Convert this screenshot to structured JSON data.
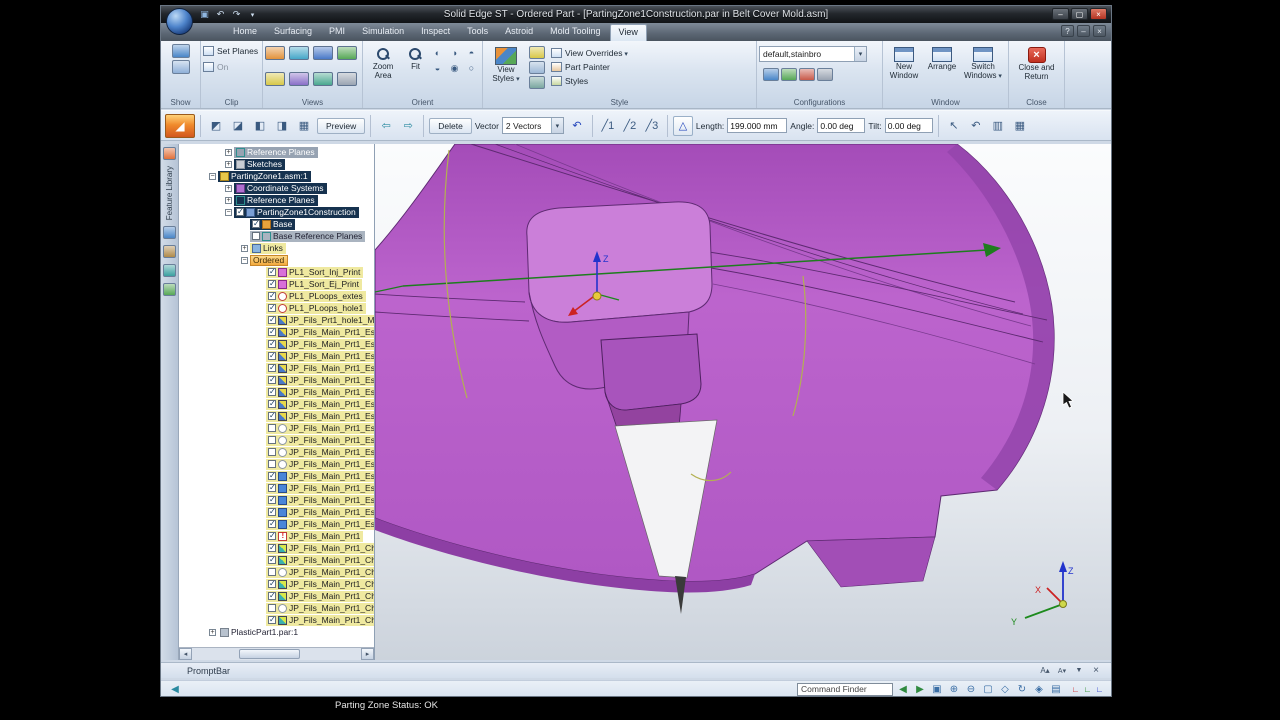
{
  "colors": {
    "model": "#bb63cc",
    "model-dark": "#8d3fa4",
    "model-light": "#cb7fd9",
    "accent-orange": "#f08a2c",
    "highlight-yellow": "#efe9a0",
    "selected-dark": "#16324f"
  },
  "window": {
    "title": "Solid Edge ST - Ordered Part - [PartingZone1Construction.par in Belt Cover Mold.asm]"
  },
  "tabs": [
    {
      "name": "tab-home",
      "label": "Home"
    },
    {
      "name": "tab-surfacing",
      "label": "Surfacing"
    },
    {
      "name": "tab-pmi",
      "label": "PMI"
    },
    {
      "name": "tab-simulation",
      "label": "Simulation"
    },
    {
      "name": "tab-inspect",
      "label": "Inspect"
    },
    {
      "name": "tab-tools",
      "label": "Tools"
    },
    {
      "name": "tab-astroid",
      "label": "Astroid"
    },
    {
      "name": "tab-mold-tooling",
      "label": "Mold Tooling"
    },
    {
      "name": "tab-view",
      "label": "View",
      "classes": [
        "active"
      ]
    }
  ],
  "ribbon": {
    "show": {
      "label": "Show"
    },
    "clip": {
      "label": "Clip",
      "set_planes": "Set Planes",
      "on": "On"
    },
    "views": {
      "label": "Views",
      "icons": [
        {
          "name": "view-top-icon",
          "color": "#e2923c"
        },
        {
          "name": "view-front-icon",
          "color": "#46a7c8"
        },
        {
          "name": "view-right-icon",
          "color": "#4979c8"
        },
        {
          "name": "view-iso-icon",
          "color": "#57a857"
        },
        {
          "name": "view-dimetric-icon",
          "color": "#d8c84a"
        },
        {
          "name": "view-trimetric-icon",
          "color": "#8a6fc8"
        },
        {
          "name": "view-bottom-icon",
          "color": "#4aa890"
        },
        {
          "name": "view-back-icon",
          "color": "#9aa4b2"
        }
      ]
    },
    "orient": {
      "label": "Orient",
      "zoom_area": "Zoom Area",
      "fit": "Fit",
      "icons": [
        {
          "name": "pan-icon",
          "glyph": "◐"
        },
        {
          "name": "rotate-icon",
          "glyph": "◑"
        },
        {
          "name": "spin-about-icon",
          "glyph": "◓"
        },
        {
          "name": "look-at-face-icon",
          "glyph": "◒"
        },
        {
          "name": "camera-icon",
          "glyph": "◉"
        },
        {
          "name": "walk-icon",
          "glyph": "○"
        }
      ]
    },
    "style": {
      "label": "Style",
      "view_styles": "View Styles",
      "view_overrides": "View Overrides",
      "part_painter": "Part Painter",
      "styles": "Styles"
    },
    "configurations": {
      "label": "Configurations",
      "value": "default,stainbro",
      "icons": [
        {
          "name": "config-save-icon",
          "color": "#4a86c8"
        },
        {
          "name": "config-apply-icon",
          "color": "#57a857"
        },
        {
          "name": "config-delete-icon",
          "color": "#c85a4a"
        },
        {
          "name": "config-manage-icon",
          "color": "#9aa4b2"
        }
      ]
    },
    "window_group": {
      "label": "Window",
      "new_window": "New Window",
      "arrange": "Arrange",
      "switch_windows": "Switch Windows"
    },
    "close_group": {
      "label": "Close",
      "close_and_return": "Close and Return"
    }
  },
  "command_bar": {
    "steps": [
      {
        "name": "select-step-icon",
        "glyph": "◩"
      },
      {
        "name": "extend-step-icon",
        "glyph": "◪"
      },
      {
        "name": "side-1-step-icon",
        "glyph": "◧"
      },
      {
        "name": "side-2-step-icon",
        "glyph": "◨"
      },
      {
        "name": "surface-step-icon",
        "glyph": "▦"
      }
    ],
    "preview": "Preview",
    "nav": [
      {
        "name": "previous-step-icon",
        "glyph": "⇦"
      },
      {
        "name": "next-step-icon",
        "glyph": "⇨"
      }
    ],
    "delete": "Delete",
    "vector_label": "Vector",
    "vector_value": "2 Vectors",
    "flip_glyph": "↶",
    "modes": [
      {
        "name": "single-vector-icon",
        "glyph": "╱1"
      },
      {
        "name": "double-vector-icon",
        "glyph": "╱2"
      },
      {
        "name": "multi-vector-icon",
        "glyph": "╱3"
      }
    ],
    "delta_glyph": "△",
    "length_label": "Length:",
    "length_value": "199.000 mm",
    "angle_label": "Angle:",
    "angle_value": "0.00 deg",
    "tilt_label": "Tilt:",
    "tilt_value": "0.00 deg",
    "right_icons": [
      {
        "name": "select-tool-icon",
        "glyph": "↖"
      },
      {
        "name": "undo-step-icon",
        "glyph": "↶"
      },
      {
        "name": "snap-options-icon",
        "glyph": "▥"
      },
      {
        "name": "display-options-icon",
        "glyph": "▦"
      }
    ]
  },
  "left_strip": {
    "feature_library": "Feature Library"
  },
  "pathfinder": {
    "rows": [
      {
        "label": "Reference Planes",
        "style": "gray",
        "icon": "planes",
        "indent": 2,
        "expand": "plus"
      },
      {
        "label": "Sketches",
        "style": "dark",
        "icon": "sketch",
        "indent": 2,
        "expand": "plus"
      },
      {
        "label": "PartingZone1.asm:1",
        "style": "dark",
        "icon": "asm",
        "indent": 1,
        "expand": "minus"
      },
      {
        "label": "Coordinate Systems",
        "style": "dark",
        "icon": "csys",
        "indent": 2,
        "expand": "plus"
      },
      {
        "label": "Reference Planes",
        "style": "dark",
        "icon": "planes",
        "indent": 2,
        "expand": "plus"
      },
      {
        "label": "PartingZone1Construction",
        "style": "dark",
        "icon": "part",
        "state": "checked",
        "indent": 2,
        "expand": "minus"
      },
      {
        "label": "Base",
        "style": "dark",
        "icon": "base",
        "state": "checked",
        "indent": 3
      },
      {
        "label": "Base Reference Planes",
        "style": "gray2",
        "icon": "planes",
        "state": "unchecked",
        "indent": 3
      },
      {
        "label": "Links",
        "style": "yellow",
        "icon": "links",
        "indent": 3,
        "expand": "plus"
      },
      {
        "label": "Ordered",
        "style": "header",
        "indent": 3,
        "expand": "minus"
      },
      {
        "label": "PL1_Sort_Inj_Print",
        "style": "yellow",
        "icon": "surf",
        "state": "checked",
        "indent": 4
      },
      {
        "label": "PL1_Sort_Ej_Print",
        "style": "yellow",
        "icon": "surf",
        "state": "checked",
        "indent": 4
      },
      {
        "label": "PL1_PLoops_extes",
        "style": "yellow",
        "icon": "loop",
        "state": "checked",
        "indent": 4
      },
      {
        "label": "PL1_PLoops_hole1",
        "style": "yellow",
        "icon": "loop",
        "state": "checked",
        "indent": 4
      },
      {
        "label": "JP_Fils_Prt1_hole1_M...",
        "style": "yellow",
        "icon": "fill",
        "state": "checked",
        "indent": 4
      },
      {
        "label": "JP_Fils_Main_Prt1_Es...",
        "style": "yellow",
        "icon": "fill",
        "state": "checked",
        "indent": 4
      },
      {
        "label": "JP_Fils_Main_Prt1_Es...",
        "style": "yellow",
        "icon": "fill",
        "state": "checked",
        "indent": 4
      },
      {
        "label": "JP_Fils_Main_Prt1_Es...",
        "style": "yellow",
        "icon": "fill",
        "state": "checked",
        "indent": 4
      },
      {
        "label": "JP_Fils_Main_Prt1_Es...",
        "style": "yellow",
        "icon": "fill",
        "state": "checked",
        "indent": 4
      },
      {
        "label": "JP_Fils_Main_Prt1_Es...",
        "style": "yellow",
        "icon": "fill",
        "state": "checked",
        "indent": 4
      },
      {
        "label": "JP_Fils_Main_Prt1_Es...",
        "style": "yellow",
        "icon": "fill",
        "state": "checked",
        "indent": 4
      },
      {
        "label": "JP_Fils_Main_Prt1_Es...",
        "style": "yellow",
        "icon": "fill",
        "state": "checked",
        "indent": 4
      },
      {
        "label": "JP_Fils_Main_Prt1_Es...",
        "style": "yellow",
        "icon": "fill",
        "state": "checked",
        "indent": 4
      },
      {
        "label": "JP_Fils_Main_Prt1_Es...",
        "style": "yellow",
        "icon": "loop2",
        "state": "unchecked",
        "indent": 4
      },
      {
        "label": "JP_Fils_Main_Prt1_Es...",
        "style": "yellow",
        "icon": "loop2",
        "state": "unchecked",
        "indent": 4
      },
      {
        "label": "JP_Fils_Main_Prt1_Es...",
        "style": "yellow",
        "icon": "loop2",
        "state": "unchecked",
        "indent": 4
      },
      {
        "label": "JP_Fils_Main_Prt1_Es...",
        "style": "yellow",
        "icon": "loop2",
        "state": "unchecked",
        "indent": 4
      },
      {
        "label": "JP_Fils_Main_Prt1_Es_",
        "style": "yellow",
        "icon": "blue",
        "state": "checked",
        "indent": 4
      },
      {
        "label": "JP_Fils_Main_Prt1_Es_",
        "style": "yellow",
        "icon": "blue",
        "state": "checked",
        "indent": 4
      },
      {
        "label": "JP_Fils_Main_Prt1_Es_",
        "style": "yellow",
        "icon": "blue",
        "state": "checked",
        "indent": 4
      },
      {
        "label": "JP_Fils_Main_Prt1_Es_",
        "style": "yellow",
        "icon": "blue",
        "state": "checked",
        "indent": 4
      },
      {
        "label": "JP_Fils_Main_Prt1_Es_",
        "style": "yellow",
        "icon": "blue",
        "state": "checked",
        "indent": 4
      },
      {
        "label": "JP_Fils_Main_Prt1",
        "style": "yellow",
        "icon": "warn",
        "state": "checked",
        "indent": 4
      },
      {
        "label": "JP_Fils_Main_Prt1_Ch...",
        "style": "yellow",
        "icon": "fill2",
        "state": "checked",
        "indent": 4
      },
      {
        "label": "JP_Fils_Main_Prt1_Ch...",
        "style": "yellow",
        "icon": "fill2",
        "state": "checked",
        "indent": 4
      },
      {
        "label": "JP_Fils_Main_Prt1_Ch...",
        "style": "yellow",
        "icon": "loop2",
        "state": "unchecked",
        "indent": 4
      },
      {
        "label": "JP_Fils_Main_Prt1_Ch...",
        "style": "yellow",
        "icon": "fill2",
        "state": "checked",
        "indent": 4
      },
      {
        "label": "JP_Fils_Main_Prt1_Ch...",
        "style": "yellow",
        "icon": "fill2",
        "state": "checked",
        "indent": 4
      },
      {
        "label": "JP_Fils_Main_Prt1_Ch...",
        "style": "yellow",
        "icon": "loop2",
        "state": "unchecked",
        "indent": 4
      },
      {
        "label": "JP_Fils_Main_Prt1_Ch...",
        "style": "yellow",
        "icon": "fill2",
        "state": "checked",
        "indent": 4
      },
      {
        "label": "PlasticPart1.par:1",
        "style": "plain",
        "icon": "part2",
        "indent": 1,
        "expand": "plus"
      }
    ]
  },
  "viewport": {
    "center_triad": {
      "z": "Z"
    },
    "corner_triad": {
      "z": "Z",
      "x": "X",
      "y": "Y"
    }
  },
  "prompt_bar": {
    "label": "PromptBar"
  },
  "status": {
    "message": "Parting Zone Status: OK",
    "command_finder": "Command Finder",
    "icons": [
      {
        "name": "view-previous-icon",
        "glyph": "◀",
        "color": "#2f8a3f"
      },
      {
        "name": "view-next-icon",
        "glyph": "▶",
        "color": "#2f8a3f"
      },
      {
        "name": "zoom-area-icon",
        "glyph": "▣",
        "color": "#3a6ea5"
      },
      {
        "name": "zoom-in-icon",
        "glyph": "⊕",
        "color": "#3a6ea5"
      },
      {
        "name": "zoom-out-icon",
        "glyph": "⊖",
        "color": "#3a6ea5"
      },
      {
        "name": "fit-icon",
        "glyph": "▢",
        "color": "#3a6ea5"
      },
      {
        "name": "pan-icon",
        "glyph": "◇",
        "color": "#3a6ea5"
      },
      {
        "name": "rotate-view-icon",
        "glyph": "↻",
        "color": "#3a6ea5"
      },
      {
        "name": "common-views-icon",
        "glyph": "◈",
        "color": "#3a6ea5"
      },
      {
        "name": "view-styles-icon",
        "glyph": "▤",
        "color": "#3a6ea5"
      }
    ],
    "axis_icons": [
      {
        "name": "axis-x-icon",
        "glyph": "∟",
        "color": "#cc2222"
      },
      {
        "name": "axis-y-icon",
        "glyph": "∟",
        "color": "#1d8a1d"
      },
      {
        "name": "axis-z-icon",
        "glyph": "∟",
        "color": "#2233cc"
      }
    ]
  }
}
